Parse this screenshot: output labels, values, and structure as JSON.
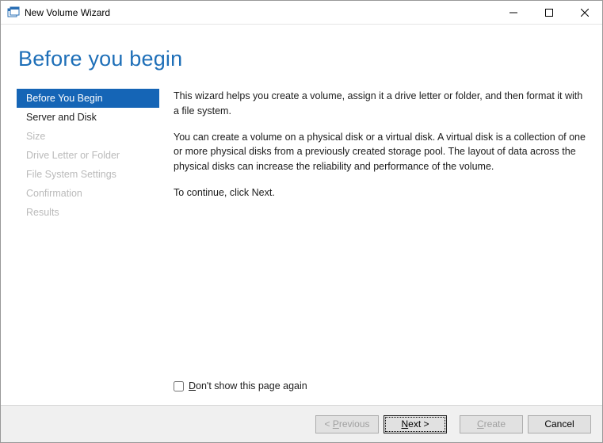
{
  "window": {
    "title": "New Volume Wizard"
  },
  "header": {
    "title": "Before you begin"
  },
  "sidebar": {
    "items": [
      {
        "label": "Before You Begin",
        "enabled": true,
        "selected": true
      },
      {
        "label": "Server and Disk",
        "enabled": true,
        "selected": false
      },
      {
        "label": "Size",
        "enabled": false,
        "selected": false
      },
      {
        "label": "Drive Letter or Folder",
        "enabled": false,
        "selected": false
      },
      {
        "label": "File System Settings",
        "enabled": false,
        "selected": false
      },
      {
        "label": "Confirmation",
        "enabled": false,
        "selected": false
      },
      {
        "label": "Results",
        "enabled": false,
        "selected": false
      }
    ]
  },
  "main": {
    "para1": "This wizard helps you create a volume, assign it a drive letter or folder, and then format it with a file system.",
    "para2": "You can create a volume on a physical disk or a virtual disk. A virtual disk is a collection of one or more physical disks from a previously created storage pool. The layout of data across the physical disks can increase the reliability and performance of the volume.",
    "para3": "To continue, click Next.",
    "dont_show_label_pre": "D",
    "dont_show_label_post": "on't show this page again"
  },
  "footer": {
    "previous_pre": "< ",
    "previous_key": "P",
    "previous_post": "revious",
    "next_key": "N",
    "next_post": "ext >",
    "create_key": "C",
    "create_post": "reate",
    "cancel": "Cancel"
  }
}
